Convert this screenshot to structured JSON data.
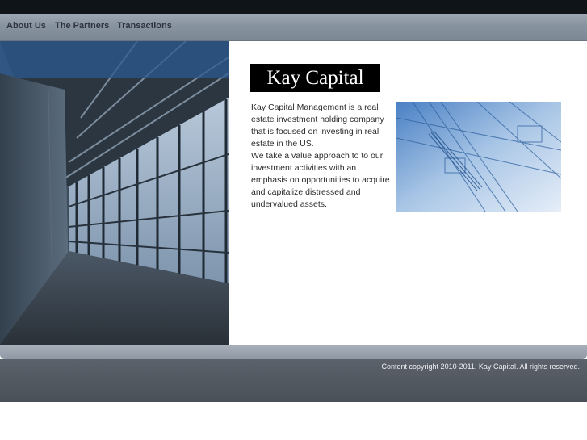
{
  "nav": {
    "items": [
      {
        "label": "About Us"
      },
      {
        "label": "The Partners"
      },
      {
        "label": "Transactions"
      }
    ]
  },
  "logo": {
    "text": "Kay Capital"
  },
  "intro": {
    "paragraph1": "Kay Capital Management is a real estate investment holding company that is focused on investing in real estate in the US.",
    "paragraph2": "We take a value approach to to our investment activities with an emphasis on opportunities to acquire and capitalize distressed and undervalued assets."
  },
  "images": {
    "hero": "corridor-photo",
    "side": "blueprint-photo"
  },
  "footer": {
    "copyright": "Content copyright 2010-2011. Kay Capital. All rights reserved."
  },
  "colors": {
    "topbar": "#0e1418",
    "nav": "#8893a0",
    "nav_text": "#2d3440",
    "footer": "#4f565e"
  }
}
